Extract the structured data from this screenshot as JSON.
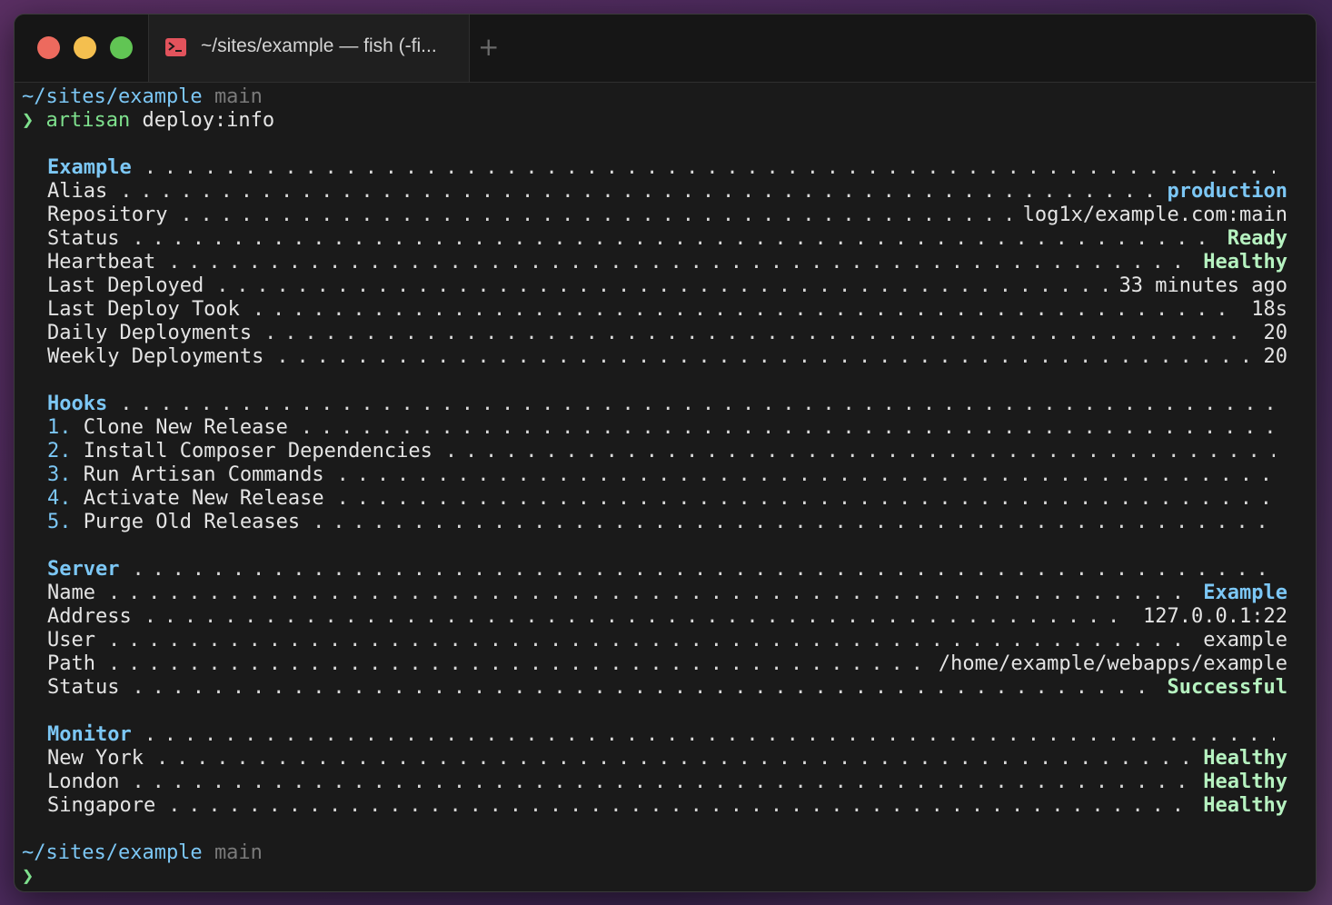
{
  "window": {
    "tab_title": "~/sites/example — fish (-fi...",
    "new_tab_symbol": "+",
    "tab_icon": "terminal-icon"
  },
  "prompt": {
    "cwd": "~/sites/example",
    "branch": "main",
    "symbol": "❯"
  },
  "command": {
    "name": "artisan",
    "args": "deploy:info"
  },
  "sections": {
    "example": {
      "title": "Example",
      "rows": [
        {
          "key": "Alias",
          "value": "production"
        },
        {
          "key": "Repository",
          "value": "log1x/example.com:main"
        },
        {
          "key": "Status",
          "value": "Ready"
        },
        {
          "key": "Heartbeat",
          "value": "Healthy"
        },
        {
          "key": "Last Deployed",
          "value": "33 minutes ago"
        },
        {
          "key": "Last Deploy Took",
          "value": "18s"
        },
        {
          "key": "Daily Deployments",
          "value": "20"
        },
        {
          "key": "Weekly Deployments",
          "value": "20"
        }
      ]
    },
    "hooks": {
      "title": "Hooks",
      "items": [
        {
          "num": "1.",
          "label": "Clone New Release"
        },
        {
          "num": "2.",
          "label": "Install Composer Dependencies"
        },
        {
          "num": "3.",
          "label": "Run Artisan Commands"
        },
        {
          "num": "4.",
          "label": "Activate New Release"
        },
        {
          "num": "5.",
          "label": "Purge Old Releases"
        }
      ]
    },
    "server": {
      "title": "Server",
      "rows": [
        {
          "key": "Name",
          "value": "Example"
        },
        {
          "key": "Address",
          "value": "127.0.0.1:22"
        },
        {
          "key": "User",
          "value": "example"
        },
        {
          "key": "Path",
          "value": "/home/example/webapps/example"
        },
        {
          "key": "Status",
          "value": "Successful"
        }
      ]
    },
    "monitor": {
      "title": "Monitor",
      "rows": [
        {
          "key": "New York",
          "value": "Healthy"
        },
        {
          "key": "London",
          "value": "Healthy"
        },
        {
          "key": "Singapore",
          "value": "Healthy"
        }
      ]
    }
  },
  "colors": {
    "accent_blue": "#7cc7f5",
    "status_green": "#b6f2c0",
    "prompt_green": "#7ee08d",
    "branch_gray": "#7a7a7a",
    "terminal_bg": "#1a1a1a"
  }
}
